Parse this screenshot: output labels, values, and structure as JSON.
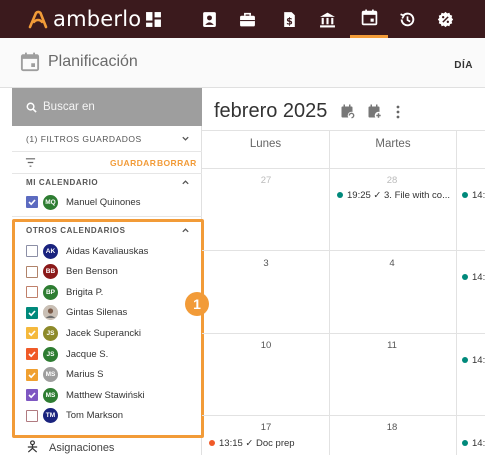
{
  "app": {
    "brand": "amberlo",
    "nav_icons": [
      "dashboard-icon",
      "contacts-icon",
      "matters-icon",
      "billing-icon",
      "bank-icon",
      "calendar-icon",
      "time-tracking-icon",
      "expenses-icon"
    ],
    "active_nav": "calendar-icon",
    "colors": {
      "topbar": "#3b1a1d",
      "accent": "#f29b38"
    }
  },
  "page": {
    "title": "Planificación",
    "view": "DÍA"
  },
  "sidebar": {
    "search_placeholder": "Buscar en",
    "saved_filters": "(1)  FILTROS GUARDADOS",
    "save_label": "GUARDAR",
    "clear_label": "BORRAR",
    "my_calendar": {
      "title": "MI CALENDARIO",
      "items": [
        {
          "name": "Manuel Quinones",
          "initials": "MQ",
          "checked": true,
          "box_color": "#5c6bc0",
          "avatar_color": "#2e7d32"
        }
      ]
    },
    "other_calendars": {
      "title": "OTROS CALENDARIOS",
      "items": [
        {
          "name": "Aidas Kavaliauskas",
          "initials": "AK",
          "checked": false,
          "box_color": "#8c8fa6",
          "avatar_color": "#1a237e"
        },
        {
          "name": "Ben Benson",
          "initials": "BB",
          "checked": false,
          "box_color": "#b0836a",
          "avatar_color": "#8b1a1a"
        },
        {
          "name": "Brigita P.",
          "initials": "BP",
          "checked": false,
          "box_color": "#c0806a",
          "avatar_color": "#2e7d32"
        },
        {
          "name": "Gintas Silenas",
          "initials": "",
          "checked": true,
          "box_color": "#00897b",
          "avatar_color": "#c9bfb5"
        },
        {
          "name": "Jacek Superancki",
          "initials": "JS",
          "checked": true,
          "box_color": "#f5b93c",
          "avatar_color": "#8d8a2a"
        },
        {
          "name": "Jacque S.",
          "initials": "JS",
          "checked": true,
          "box_color": "#f05a28",
          "avatar_color": "#2e7d32"
        },
        {
          "name": "Marius S",
          "initials": "MS",
          "checked": true,
          "box_color": "#f0a030",
          "avatar_color": "#9e9e9e"
        },
        {
          "name": "Matthew Stawiński",
          "initials": "MS",
          "checked": true,
          "box_color": "#7e57c2",
          "avatar_color": "#2e7d32"
        },
        {
          "name": "Tom Markson",
          "initials": "TM",
          "checked": false,
          "box_color": "#b07a80",
          "avatar_color": "#1a237e"
        }
      ]
    },
    "assignments": "Asignaciones",
    "badge": "1"
  },
  "calendar": {
    "title": "febrero 2025",
    "day_headers": [
      "Lunes",
      "Martes"
    ],
    "weeks": [
      {
        "mon": "27",
        "tue": "28",
        "mon_dim": true,
        "tue_dim": true
      },
      {
        "mon": "3",
        "tue": "4",
        "mon_dim": false,
        "tue_dim": false
      },
      {
        "mon": "10",
        "tue": "11",
        "mon_dim": false,
        "tue_dim": false
      },
      {
        "mon": "17",
        "tue": "18",
        "mon_dim": false,
        "tue_dim": false
      }
    ],
    "events": [
      {
        "text": "19:25 ✓ 3. File with co...",
        "color": "#00897b"
      },
      {
        "text": "13:15 ✓ Doc prep",
        "color": "#f05a28"
      }
    ],
    "partial_events": [
      "14:",
      "14:",
      "14:",
      "14:"
    ]
  }
}
